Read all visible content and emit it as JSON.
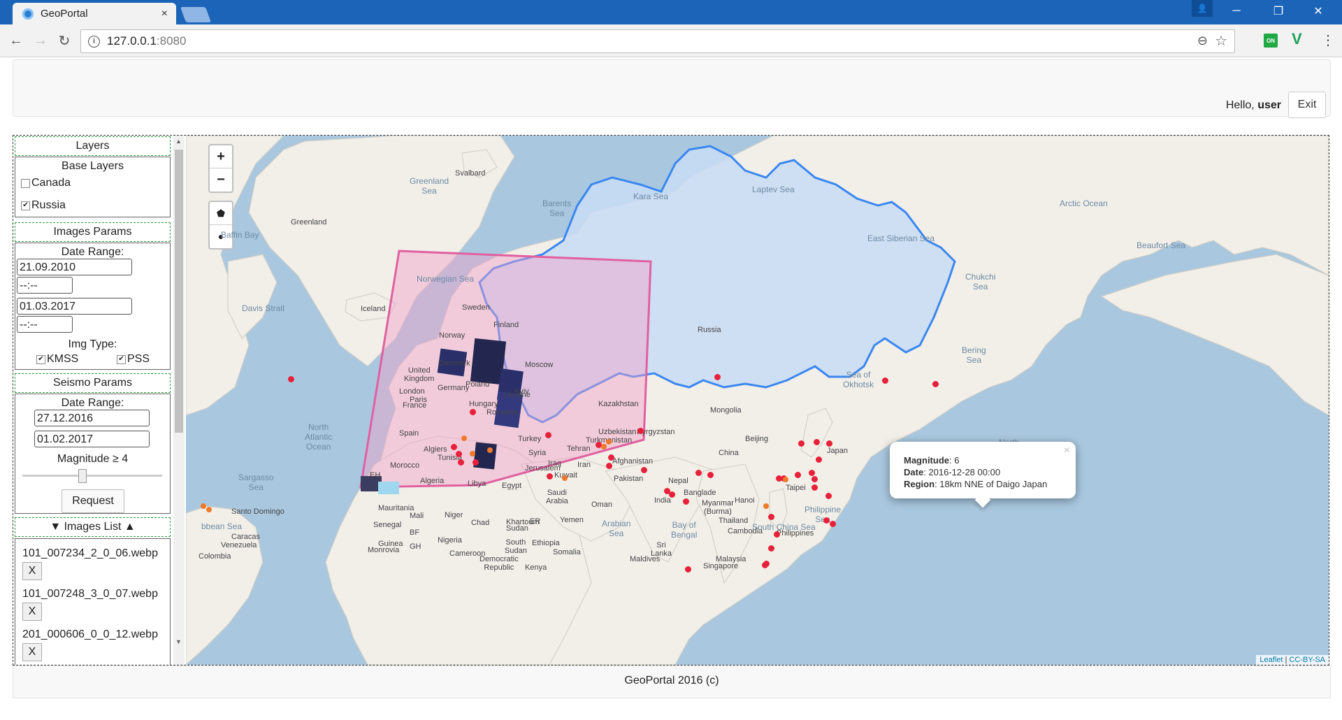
{
  "browser": {
    "tab_title": "GeoPortal",
    "tab_close": "×",
    "url_host": "127.0.0.1",
    "url_port": ":8080",
    "back_icon": "←",
    "forward_icon": "→",
    "reload_icon": "↻",
    "zoom_icon": "⊖",
    "star_icon": "☆",
    "ext_on_label": "ON",
    "ext_v_label": "V",
    "menu_icon": "⋮",
    "profile_icon": "👤",
    "minimize_icon": "─",
    "restore_icon": "❐",
    "close_icon": "✕"
  },
  "header": {
    "hello_prefix": "Hello, ",
    "username": "user",
    "exit_label": "Exit"
  },
  "sidebar": {
    "layers_title": "Layers",
    "base_layers_title": "Base Layers",
    "base_layers": [
      {
        "label": "Canada",
        "checked": false
      },
      {
        "label": "Russia",
        "checked": true
      }
    ],
    "images_params_title": "Images Params",
    "date_range_label": "Date Range:",
    "image_date_from": "21.09.2010",
    "image_time_from": "--:--",
    "image_date_to": "01.03.2017",
    "image_time_to": "--:--",
    "img_type_label": "Img Type:",
    "img_types": [
      {
        "label": "KMSS",
        "checked": true
      },
      {
        "label": "PSS",
        "checked": true
      }
    ],
    "seismo_params_title": "Seismo Params",
    "seismo_date_range_label": "Date Range:",
    "seismo_date_from": "27.12.2016",
    "seismo_date_to": "01.02.2017",
    "magnitude_label": "Magnitude ≥ 4",
    "magnitude_value": 4,
    "request_label": "Request",
    "images_list_title": "▼ Images List ▲",
    "images": [
      {
        "name": "101_007234_2_0_06.webp",
        "remove": "X"
      },
      {
        "name": "101_007248_3_0_07.webp",
        "remove": "X"
      },
      {
        "name": "201_000606_0_0_12.webp",
        "remove": "X"
      }
    ]
  },
  "map": {
    "zoom_in": "+",
    "zoom_out": "−",
    "draw_polygon_icon": "⬟",
    "draw_circle_icon": "●",
    "labels": {
      "greenland_sea": "Greenland\nSea",
      "svalbard": "Svalbard",
      "barents_sea": "Barents\nSea",
      "kara_sea": "Kara Sea",
      "laptev_sea": "Laptev Sea",
      "east_siberian_sea": "East Siberian Sea",
      "arctic_ocean": "Arctic Ocean",
      "beaufort_sea": "Beaufort Sea",
      "chukchi_sea": "Chukchi\nSea",
      "greenland": "Greenland",
      "baffin_bay": "Baffin Bay",
      "davis_strait": "Davis Strait",
      "iceland": "Iceland",
      "norwegian_sea": "Norwegian Sea",
      "sweden": "Sweden",
      "finland": "Finland",
      "norway": "Norway",
      "russia": "Russia",
      "bering_sea": "Bering\nSea",
      "sea_of_okhotsk": "Sea of\nOkhotsk",
      "denmark": "Denmark",
      "united_kingdom": "United\nKingdom",
      "moscow": "Moscow",
      "poland": "Poland",
      "germany": "Germany",
      "london": "London",
      "ukraine": "Ukraine",
      "kyiv": "Kyiv",
      "paris": "Paris",
      "france": "France",
      "hungary": "Hungary",
      "romania": "Romania",
      "spain": "Spain",
      "kazakhstan": "Kazakhstan",
      "mongolia": "Mongolia",
      "north_atlantic_ocean": "North\nAtlantic\nOcean",
      "turkey": "Turkey",
      "uzbekistan": "Uzbekistan",
      "kyrgyzstan": "Kyrgyzstan",
      "turkmenistan": "Turkmenistan",
      "algiers": "Algiers",
      "tunisia": "Tunisia",
      "syria": "Syria",
      "tehran": "Tehran",
      "beijing": "Beijing",
      "china": "China",
      "japan": "Japan",
      "north_pacific_ocean": "North\nPacific\nOcean",
      "morocco": "Morocco",
      "algeria": "Algeria",
      "iraq": "Iraq",
      "iran": "Iran",
      "jerusalem": "Jerusalem",
      "afghanistan": "Afghanistan",
      "libya": "Libya",
      "egypt": "Egypt",
      "kuwait": "Kuwait",
      "pakistan": "Pakistan",
      "nepal": "Nepal",
      "sargasso_sea": "Sargasso\nSea",
      "saudi_arabia": "Saudi\nArabia",
      "taipei": "Taipei",
      "mauritania": "Mauritania",
      "india": "India",
      "bangladesh": "Banglade",
      "hanoi": "Hanoi",
      "oman": "Oman",
      "myanmar": "Myanmar\n(Burma)",
      "philippine_sea": "Philippine\nSea",
      "santo_domingo": "Santo Domingo",
      "mali": "Mali",
      "niger": "Niger",
      "chad": "Chad",
      "khartoum": "Khartoum",
      "yemen": "Yemen",
      "arabian_sea": "Arabian\nSea",
      "caribbean_sea": "bbean Sea",
      "senegal": "Senegal",
      "sudan": "Sudan",
      "er": "ER",
      "bay_of_bengal": "Bay of\nBengal",
      "thailand": "Thailand",
      "caracas": "Caracas",
      "venezuela": "Venezuela",
      "bf": "BF",
      "nigeria": "Nigeria",
      "south_sudan": "South\nSudan",
      "ethiopia": "Ethiopia",
      "sri_lanka": "Sri\nLanka",
      "cambodia": "Cambodia",
      "philippines": "Philippines",
      "guinea": "Guinea",
      "gh": "GH",
      "colombia": "Colombia",
      "monrovia": "Monrovia",
      "cameroon": "Cameroon",
      "somalia": "Somalia",
      "maldives": "Maldives",
      "singapore": "Singapore",
      "malaysia": "Malaysia",
      "dr_congo": "Democratic\nRepublic",
      "kenya": "Kenya",
      "eh": "EH",
      "south_china_sea": "South China Sea"
    },
    "popup": {
      "magnitude_label": "Magnitude",
      "magnitude_value": ": 6",
      "date_label": "Date",
      "date_value": ": 2016-12-28 00:00",
      "region_label": "Region",
      "region_value": ": 18km NNE of Daigo Japan",
      "close": "×"
    },
    "attribution_leaflet": "Leaflet",
    "attribution_sep": " | ",
    "attribution_source": "CC-BY-SA",
    "colors": {
      "water": "#a9c8e0",
      "land": "#f2efe9",
      "russia_fill": "#c9dcf5",
      "russia_stroke": "#3a87f0",
      "area_fill": "#f0a0c8",
      "area_stroke": "#e060a0",
      "quake_major": "#e8213a",
      "quake_minor": "#f07a2a"
    }
  },
  "footer": {
    "text": "GeoPortal 2016 (c)"
  }
}
